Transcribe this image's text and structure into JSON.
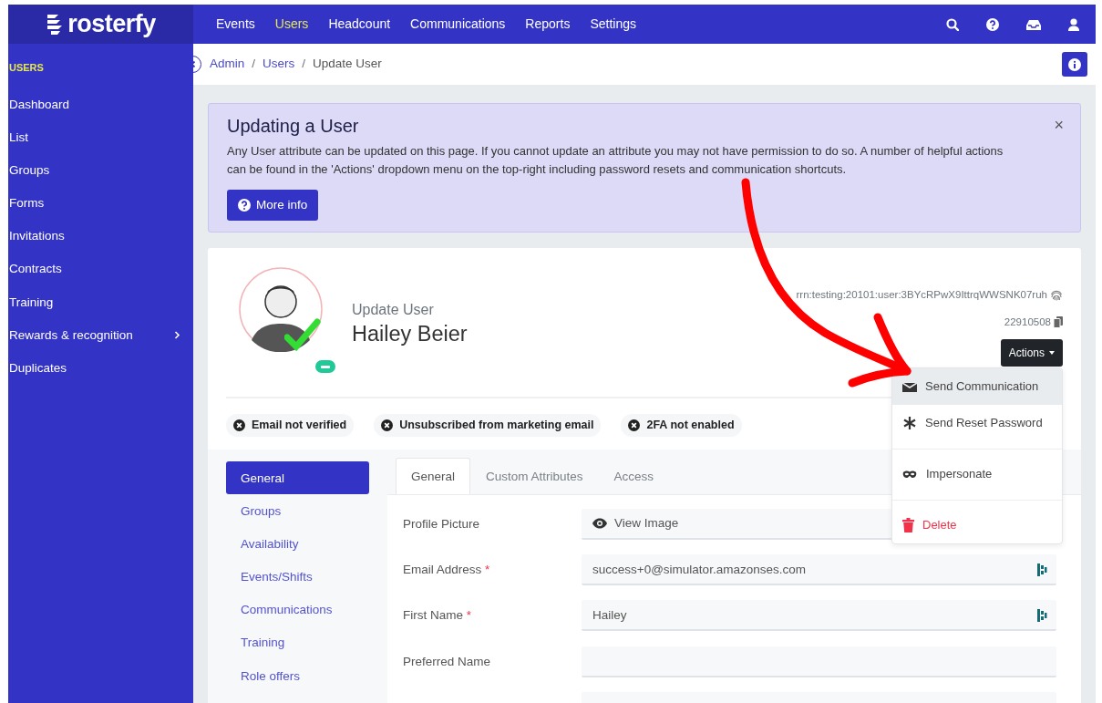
{
  "brand": {
    "name": "rosterfy"
  },
  "topnav": [
    {
      "label": "Events",
      "selected": false
    },
    {
      "label": "Users",
      "selected": true
    },
    {
      "label": "Headcount",
      "selected": false
    },
    {
      "label": "Communications",
      "selected": false
    },
    {
      "label": "Reports",
      "selected": false
    },
    {
      "label": "Settings",
      "selected": false
    }
  ],
  "sidebar": {
    "heading": "USERS",
    "items": [
      {
        "label": "Dashboard",
        "has_submenu": false
      },
      {
        "label": "List",
        "has_submenu": false
      },
      {
        "label": "Groups",
        "has_submenu": false
      },
      {
        "label": "Forms",
        "has_submenu": false
      },
      {
        "label": "Invitations",
        "has_submenu": false
      },
      {
        "label": "Contracts",
        "has_submenu": false
      },
      {
        "label": "Training",
        "has_submenu": false
      },
      {
        "label": "Rewards & recognition",
        "has_submenu": true
      },
      {
        "label": "Duplicates",
        "has_submenu": false
      }
    ]
  },
  "breadcrumb": [
    {
      "label": "Admin",
      "link": true
    },
    {
      "label": "/",
      "kind": "separator"
    },
    {
      "label": "Users",
      "link": true
    },
    {
      "label": "/",
      "kind": "separator"
    },
    {
      "label": "Update User",
      "link": false
    }
  ],
  "alert": {
    "title": "Updating a User",
    "text": "Any User attribute can be updated on this page. If you cannot update an attribute you may not have permission to do so. A number of helpful actions can be found in the 'Actions' dropdown menu on the top-right including password resets and communication shortcuts.",
    "close": "×",
    "button": "More info"
  },
  "profile": {
    "subtitle": "Update User",
    "name": "Hailey Beier",
    "verified": true,
    "identifier": "rrn:testing:20101:user:3BYcRPwX9IttrqWWSNK07ruh",
    "number": "22910508",
    "actions_button": "Actions"
  },
  "actions_menu": [
    {
      "label": "Send Communication",
      "kind": "envelope",
      "selected": true,
      "danger": false,
      "divider_before": false
    },
    {
      "label": "Send Reset Password",
      "kind": "asterisk",
      "selected": false,
      "danger": false,
      "divider_before": false
    },
    {
      "label": "Impersonate",
      "kind": "mask",
      "selected": false,
      "danger": false,
      "divider_before": true
    },
    {
      "label": "Delete",
      "kind": "trash",
      "selected": false,
      "danger": true,
      "divider_before": true
    }
  ],
  "status_pills": [
    {
      "label": "Email not verified"
    },
    {
      "label": "Unsubscribed from marketing email"
    },
    {
      "label": "2FA not enabled"
    }
  ],
  "section_nav": [
    {
      "label": "General",
      "selected": true
    },
    {
      "label": "Groups",
      "selected": false
    },
    {
      "label": "Availability",
      "selected": false
    },
    {
      "label": "Events/Shifts",
      "selected": false
    },
    {
      "label": "Communications",
      "selected": false
    },
    {
      "label": "Training",
      "selected": false
    },
    {
      "label": "Role offers",
      "selected": false
    }
  ],
  "tabs": [
    {
      "label": "General",
      "selected": true
    },
    {
      "label": "Custom Attributes",
      "selected": false
    },
    {
      "label": "Access",
      "selected": false
    }
  ],
  "form": [
    {
      "label": "Profile Picture",
      "kind": "button",
      "value": "View Image"
    },
    {
      "label": "Email Address",
      "kind": "text",
      "value": "success+0@simulator.amazonses.com",
      "required_mark": "*",
      "autofill_icon": true
    },
    {
      "label": "First Name",
      "kind": "text",
      "value": "Hailey",
      "required_mark": "*",
      "autofill_icon": true
    },
    {
      "label": "Preferred Name",
      "kind": "text",
      "autofill_icon": false
    },
    {
      "kind": "text"
    }
  ]
}
